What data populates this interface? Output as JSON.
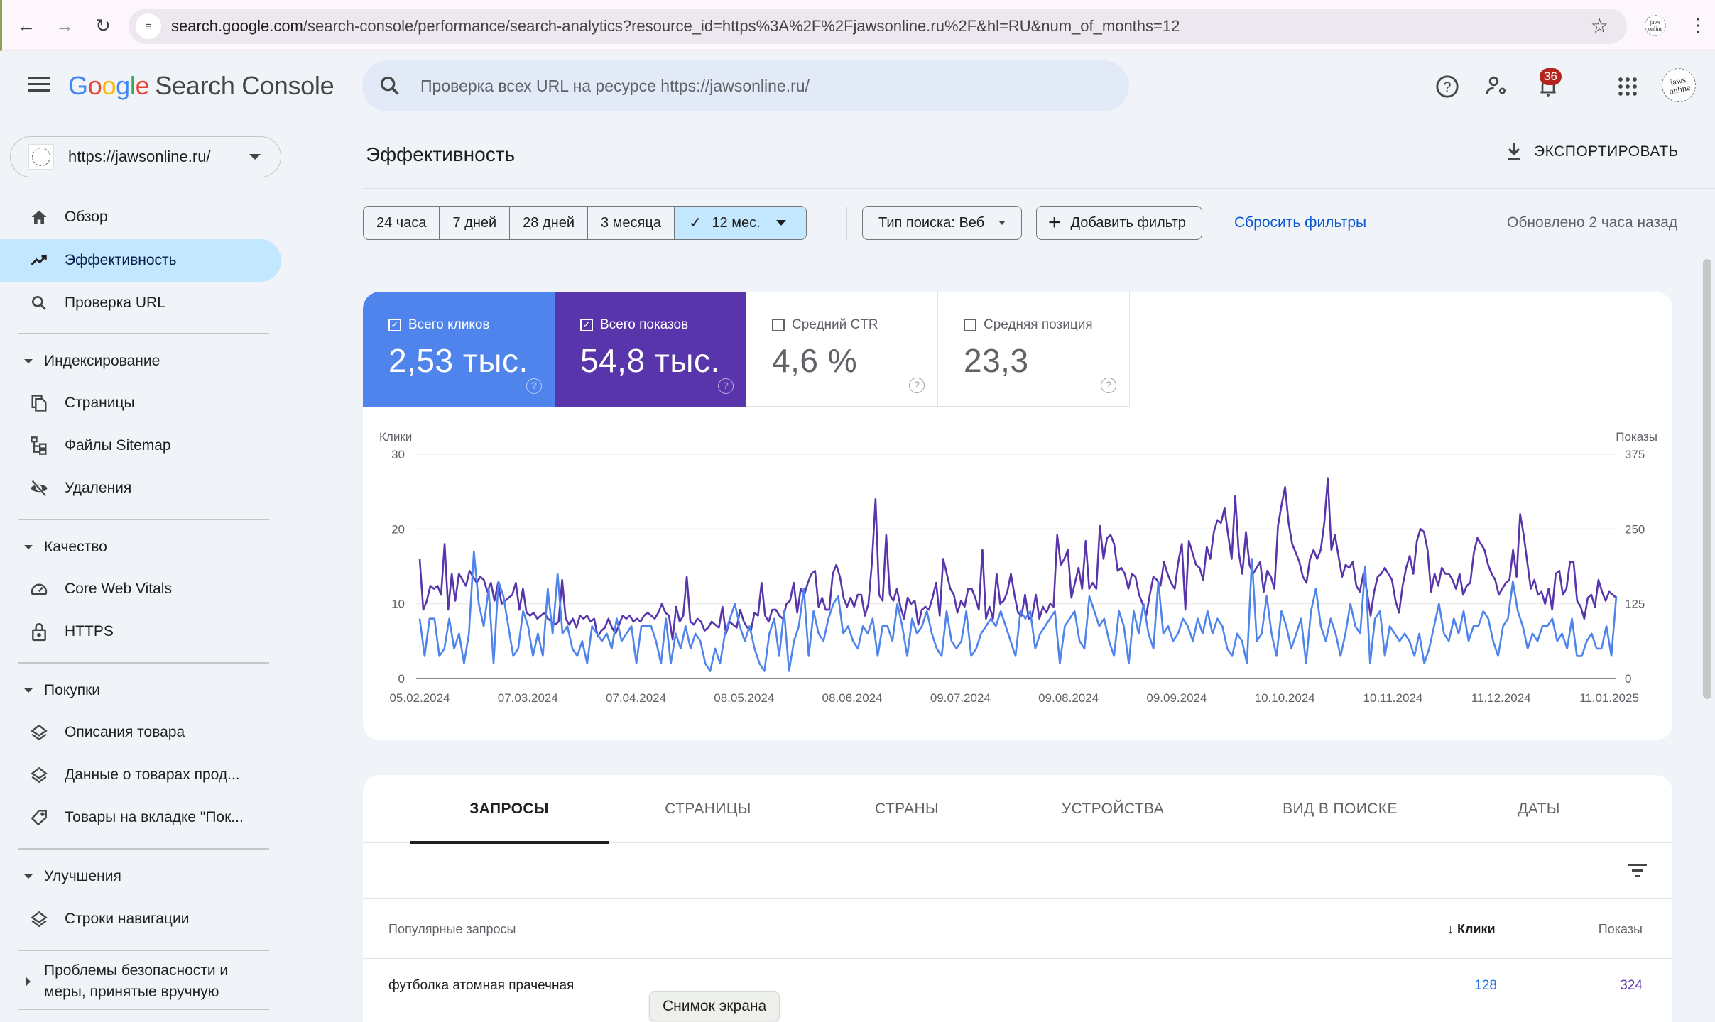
{
  "browser": {
    "url_host": "search.google.com",
    "url_rest": "/search-console/performance/search-analytics?resource_id=https%3A%2F%2Fjawsonline.ru%2F&hl=RU&num_of_months=12",
    "profile_text": "jaws online"
  },
  "header": {
    "logo_google": [
      "G",
      "o",
      "o",
      "g",
      "l",
      "e"
    ],
    "logo_product": "Search Console",
    "search_placeholder": "Проверка всех URL на ресурсе https://jawsonline.ru/",
    "notifications_count": "36",
    "avatar_text": "jaws online"
  },
  "sidebar": {
    "property": "https://jawsonline.ru/",
    "top_items": [
      {
        "label": "Обзор",
        "icon": "home-icon"
      },
      {
        "label": "Эффективность",
        "icon": "trending-up-icon",
        "active": true
      },
      {
        "label": "Проверка URL",
        "icon": "search-icon"
      }
    ],
    "sections": [
      {
        "title": "Индексирование",
        "items": [
          {
            "label": "Страницы",
            "icon": "pages-icon"
          },
          {
            "label": "Файлы Sitemap",
            "icon": "sitemap-icon"
          },
          {
            "label": "Удаления",
            "icon": "visibility-off-icon"
          }
        ]
      },
      {
        "title": "Качество",
        "items": [
          {
            "label": "Core Web Vitals",
            "icon": "speed-icon"
          },
          {
            "label": "HTTPS",
            "icon": "lock-icon"
          }
        ]
      },
      {
        "title": "Покупки",
        "items": [
          {
            "label": "Описания товара",
            "icon": "layers-icon"
          },
          {
            "label": "Данные о товарах прод...",
            "icon": "layers-icon"
          },
          {
            "label": "Товары на вкладке \"Пок...",
            "icon": "tag-icon"
          }
        ]
      },
      {
        "title": "Улучшения",
        "items": [
          {
            "label": "Строки навигации",
            "icon": "layers-icon"
          }
        ]
      },
      {
        "title": "Проблемы безопасности и меры, принятые вручную",
        "collapsed": true,
        "items": []
      }
    ]
  },
  "main": {
    "title": "Эффективность",
    "export_label": "ЭКСПОРТИРОВАТЬ",
    "date_ranges": [
      "24 часа",
      "7 дней",
      "28 дней",
      "3 месяца",
      "12 мес."
    ],
    "date_range_selected": "12 мес.",
    "search_type": "Тип поиска: Веб",
    "add_filter": "Добавить фильтр",
    "reset_filters": "Сбросить фильтры",
    "updated": "Обновлено 2 часа назад"
  },
  "metrics": [
    {
      "label": "Всего кликов",
      "value": "2,53 тыс.",
      "checked": true,
      "color": "#4e84ec"
    },
    {
      "label": "Всего показов",
      "value": "54,8 тыс.",
      "checked": true,
      "color": "#5835ab"
    },
    {
      "label": "Средний CTR",
      "value": "4,6 %",
      "checked": false
    },
    {
      "label": "Средняя позиция",
      "value": "23,3",
      "checked": false
    }
  ],
  "chart_data": {
    "type": "line",
    "title": "",
    "ylabel_left": "Клики",
    "ylabel_right": "Показы",
    "ylim_left": [
      0,
      30
    ],
    "ylim_right": [
      0,
      375
    ],
    "yticks_left": [
      "0",
      "10",
      "20",
      "30"
    ],
    "yticks_right": [
      "0",
      "125",
      "250",
      "375"
    ],
    "xtick_labels": [
      "05.02.2024",
      "07.03.2024",
      "07.04.2024",
      "08.05.2024",
      "08.06.2024",
      "09.07.2024",
      "09.08.2024",
      "09.09.2024",
      "10.10.2024",
      "10.11.2024",
      "11.12.2024",
      "11.01.2025"
    ],
    "grid": true,
    "x_note": "approx. 3-day samples from 05.02.2024 to 15.01.2025",
    "series": [
      {
        "name": "Клики",
        "axis": "left",
        "color": "#4e84ec",
        "values": [
          8,
          3,
          8,
          8,
          3,
          4,
          8,
          4,
          6,
          2,
          6,
          17,
          10,
          7,
          12,
          2,
          13,
          11,
          7,
          3,
          4,
          9,
          7,
          3,
          6,
          3,
          12,
          6,
          14,
          6,
          7,
          4,
          3,
          5,
          2,
          7,
          6,
          5,
          6,
          4,
          8,
          5,
          6,
          7,
          2,
          7,
          7,
          7,
          5,
          2,
          8,
          2,
          6,
          4,
          7,
          4,
          6,
          5,
          2,
          1,
          4,
          2,
          6,
          8,
          10,
          7,
          5,
          7,
          4,
          2,
          1,
          6,
          8,
          3,
          9,
          1,
          5,
          7,
          12,
          3,
          9,
          6,
          5,
          8,
          10,
          11,
          6,
          7,
          5,
          4,
          7,
          6,
          8,
          3,
          7,
          7,
          5,
          10,
          7,
          3,
          8,
          6,
          7,
          9,
          6,
          4,
          3,
          9,
          5,
          4,
          5,
          9,
          3,
          4,
          6,
          7,
          8,
          7,
          9,
          7,
          5,
          3,
          9,
          8,
          9,
          4,
          6,
          7,
          8,
          9,
          2,
          7,
          8,
          9,
          5,
          4,
          11,
          9,
          7,
          8,
          5,
          3,
          9,
          7,
          2,
          9,
          6,
          10,
          6,
          4,
          13,
          6,
          7,
          5,
          6,
          8,
          7,
          5,
          8,
          6,
          9,
          6,
          8,
          7,
          4,
          3,
          6,
          5,
          2,
          16,
          5,
          6,
          11,
          6,
          3,
          9,
          7,
          4,
          6,
          8,
          2,
          9,
          12,
          7,
          5,
          8,
          6,
          3,
          6,
          10,
          7,
          6,
          15,
          2,
          8,
          9,
          3,
          7,
          6,
          5,
          6,
          5,
          3,
          6,
          2,
          4,
          7,
          10,
          6,
          5,
          8,
          6,
          9,
          5,
          7,
          7,
          9,
          8,
          5,
          3,
          7,
          8,
          13,
          9,
          7,
          4,
          6,
          5,
          7,
          7,
          8,
          5,
          6,
          4,
          8,
          3,
          3,
          5,
          6,
          4,
          4,
          7,
          3,
          11
        ]
      },
      {
        "name": "Показы",
        "axis": "right",
        "color": "#5835ab",
        "values": [
          200,
          115,
          130,
          155,
          150,
          155,
          140,
          225,
          115,
          175,
          130,
          175,
          165,
          155,
          180,
          170,
          160,
          170,
          165,
          145,
          160,
          130,
          160,
          125,
          130,
          135,
          140,
          160,
          115,
          150,
          110,
          105,
          110,
          100,
          105,
          110,
          100,
          95,
          90,
          95,
          165,
          100,
          90,
          100,
          85,
          105,
          100,
          105,
          95,
          100,
          70,
          80,
          85,
          100,
          85,
          75,
          90,
          105,
          100,
          105,
          95,
          100,
          95,
          105,
          110,
          105,
          100,
          110,
          125,
          110,
          105,
          65,
          120,
          95,
          105,
          170,
          95,
          90,
          100,
          95,
          80,
          85,
          95,
          90,
          85,
          120,
          75,
          95,
          90,
          85,
          115,
          95,
          85,
          80,
          110,
          105,
          160,
          105,
          95,
          115,
          115,
          105,
          100,
          125,
          130,
          160,
          110,
          150,
          140,
          160,
          175,
          180,
          120,
          135,
          115,
          115,
          175,
          190,
          170,
          135,
          120,
          135,
          120,
          140,
          140,
          105,
          125,
          195,
          300,
          140,
          130,
          240,
          140,
          130,
          150,
          120,
          100,
          135,
          125,
          130,
          90,
          115,
          120,
          115,
          135,
          160,
          105,
          200,
          175,
          150,
          140,
          110,
          130,
          120,
          150,
          150,
          135,
          115,
          215,
          100,
          120,
          100,
          175,
          125,
          130,
          145,
          175,
          140,
          110,
          105,
          140,
          100,
          105,
          140,
          100,
          120,
          110,
          125,
          120,
          240,
          190,
          200,
          215,
          135,
          160,
          185,
          150,
          230,
          150,
          160,
          150,
          255,
          200,
          235,
          240,
          225,
          180,
          185,
          175,
          150,
          175,
          170,
          140,
          125,
          105,
          140,
          170,
          165,
          155,
          195,
          175,
          160,
          150,
          195,
          225,
          115,
          230,
          210,
          190,
          185,
          165,
          220,
          200,
          245,
          265,
          260,
          285,
          240,
          200,
          305,
          210,
          175,
          245,
          190,
          175,
          185,
          195,
          145,
          180,
          170,
          150,
          255,
          290,
          320,
          260,
          225,
          210,
          195,
          170,
          160,
          200,
          215,
          200,
          215,
          260,
          335,
          215,
          240,
          205,
          170,
          190,
          185,
          195,
          155,
          145,
          175,
          145,
          105,
          145,
          170,
          175,
          185,
          175,
          165,
          130,
          110,
          155,
          185,
          205,
          175,
          230,
          250,
          245,
          215,
          145,
          175,
          155,
          185,
          175,
          175,
          165,
          150,
          175,
          140,
          155,
          160,
          210,
          235,
          225,
          215,
          190,
          175,
          165,
          140,
          150,
          160,
          165,
          215,
          170,
          275,
          240,
          195,
          150,
          165,
          140,
          145,
          125,
          150,
          115,
          175,
          180,
          140,
          150,
          195,
          195,
          130,
          120,
          100,
          135,
          140,
          120,
          165,
          145,
          130,
          145,
          140,
          135
        ]
      }
    ]
  },
  "tabs": [
    "ЗАПРОСЫ",
    "СТРАНИЦЫ",
    "СТРАНЫ",
    "УСТРОЙСТВА",
    "ВИД В ПОИСКЕ",
    "ДАТЫ"
  ],
  "table": {
    "columns": {
      "query": "Популярные запросы",
      "clicks": "Клики",
      "impressions": "Показы"
    },
    "rows": [
      {
        "query": "футболка атомная прачечная",
        "clicks": "128",
        "impressions": "324"
      }
    ]
  },
  "tooltip": "Снимок экрана"
}
